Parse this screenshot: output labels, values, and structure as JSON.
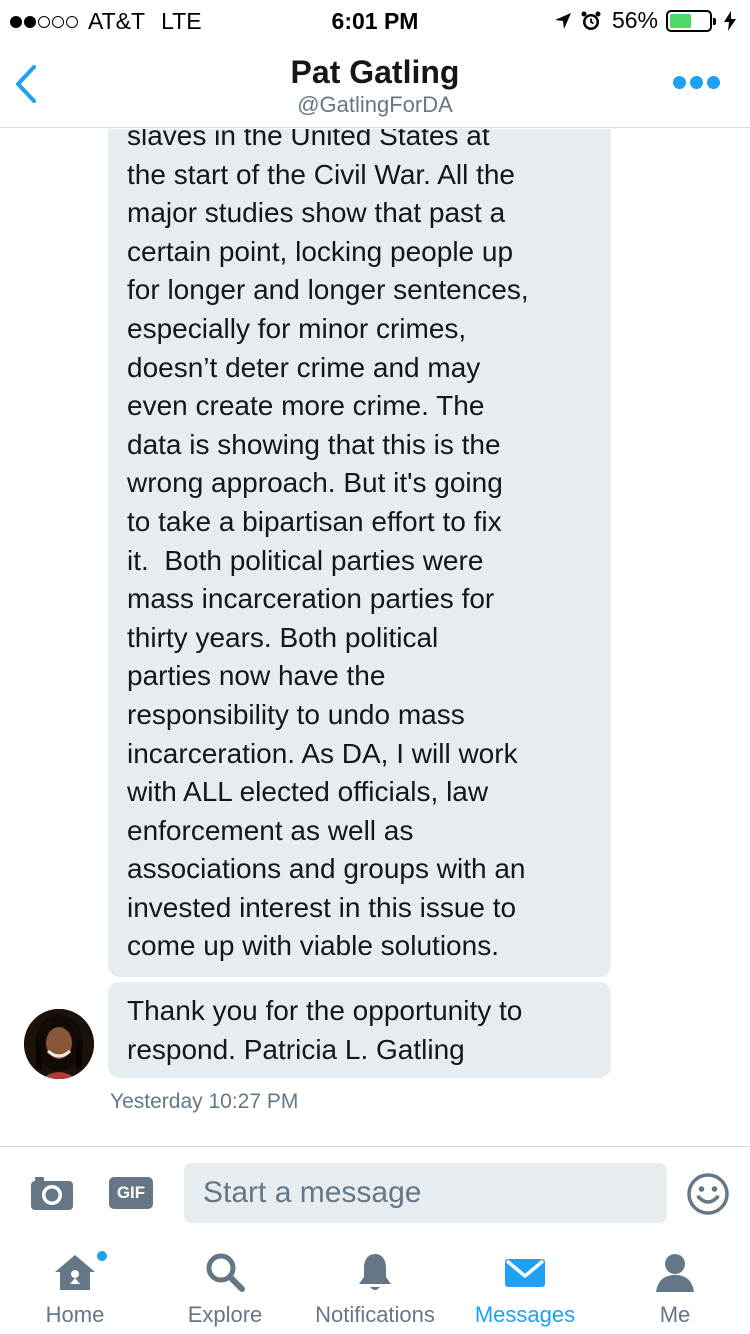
{
  "status_bar": {
    "carrier": "AT&T",
    "network": "LTE",
    "time": "6:01 PM",
    "battery_percent": "56%",
    "battery_level": 0.56
  },
  "header": {
    "title": "Pat Gatling",
    "handle": "@GatlingForDA"
  },
  "conversation": {
    "messages": [
      {
        "lines": [
          "slaves in the United States at",
          "the start of the Civil War. All the",
          "major studies show that past a",
          "certain point, locking people up",
          "for longer and longer sentences,",
          "especially for minor crimes,",
          "doesn’t deter crime and may",
          "even create more crime. The",
          "data is showing that this is the",
          "wrong approach. But it's going",
          "to take a bipartisan effort to fix",
          "it.  Both political parties were",
          "mass incarceration parties for",
          "thirty years. Both political",
          "parties now have the",
          "responsibility to undo mass",
          "incarceration. As DA, I will work",
          "with ALL elected officials, law",
          "enforcement as well as",
          "associations and groups with an",
          "invested interest in this issue to",
          "come up with viable solutions."
        ]
      },
      {
        "lines": [
          "Thank you for the opportunity to",
          "respond. Patricia L. Gatling"
        ]
      }
    ],
    "timestamp": "Yesterday 10:27 PM"
  },
  "composer": {
    "gif_label": "GIF",
    "placeholder": "Start a message"
  },
  "tabs": [
    {
      "label": "Home",
      "icon": "home-icon"
    },
    {
      "label": "Explore",
      "icon": "search-icon"
    },
    {
      "label": "Notifications",
      "icon": "bell-icon"
    },
    {
      "label": "Messages",
      "icon": "envelope-icon"
    },
    {
      "label": "Me",
      "icon": "person-icon"
    }
  ],
  "colors": {
    "accent": "#1da1f2",
    "bubble": "#e6ecf0",
    "muted": "#657786",
    "battery": "#4cd964"
  }
}
